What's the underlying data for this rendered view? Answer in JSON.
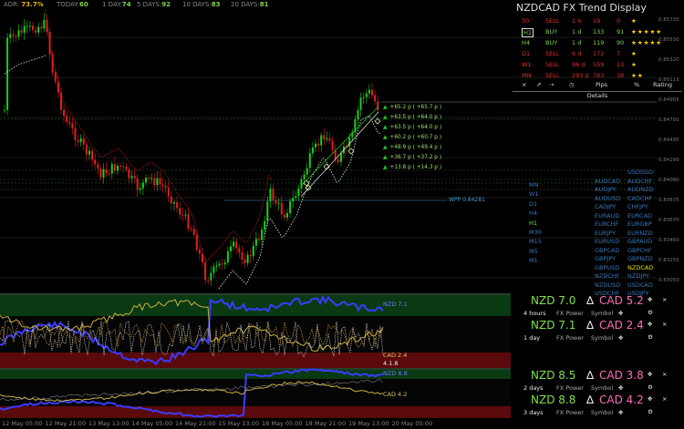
{
  "topbar": {
    "adr_label": "ADR:",
    "adr_value": "73.7%",
    "today_label": "TODAY:",
    "today_value": "60",
    "d1_label": "1 DAY:",
    "d1_value": "74",
    "d5_label": "5 DAYS:",
    "d5_value": "92",
    "d10_label": "10 DAYS:",
    "d10_value": "83",
    "d20_label": "20 DAYS:",
    "d20_value": "81"
  },
  "trend": {
    "title": "NZDCAD FX Trend Display",
    "rows": [
      {
        "tf": "30",
        "dir": "SELL",
        "age": "1 h",
        "pips": "19",
        "pct": "0",
        "stars": "★",
        "color": "#e03030"
      },
      {
        "tf": "H1",
        "dir": "BUY",
        "age": "1 d",
        "pips": "133",
        "pct": "91",
        "stars": "★★★★★",
        "color": "#7fd44f"
      },
      {
        "tf": "H4",
        "dir": "BUY",
        "age": "1 d",
        "pips": "119",
        "pct": "90",
        "stars": "★★★★★",
        "color": "#7fd44f"
      },
      {
        "tf": "D1",
        "dir": "SELL",
        "age": "6 d",
        "pips": "172",
        "pct": "7",
        "stars": "★",
        "color": "#e03030"
      },
      {
        "tf": "W1",
        "dir": "SELL",
        "age": "96 d",
        "pips": "559",
        "pct": "13",
        "stars": "★",
        "color": "#e03030"
      },
      {
        "tf": "MN",
        "dir": "SELL",
        "age": "293 d",
        "pips": "783",
        "pct": "38",
        "stars": "★★",
        "color": "#e03030"
      }
    ],
    "header_pips": "Pips",
    "header_pct": "%",
    "header_rating": "Rating",
    "details_label": "Details",
    "close_glyph": "×",
    "pin_glyph": "⇗",
    "arrow_glyph": "⇢",
    "clock_glyph": "◷"
  },
  "levels": [
    "+65.2 p ( +65.7 p )",
    "+63.5 p ( +64.0 p )",
    "+63.5 p ( +64.0 p )",
    "+60.2 p ( +60.7 p )",
    "+48.9 p ( +49.4 p )",
    "+36.7 p ( +37.2 p )",
    "+13.8 p ( +14.3 p )"
  ],
  "wpp": "WPP  0.84281",
  "matrix": {
    "tfs": [
      "MN",
      "W1",
      "D1",
      "H4",
      "H1",
      "M30",
      "M15",
      "M5",
      "M1"
    ],
    "pairs": [
      {
        "l": "",
        "r": "USDSGD"
      },
      {
        "l": "AUDCAD",
        "r": "AUDCHF"
      },
      {
        "l": "AUDJPY",
        "r": "AUDNZD"
      },
      {
        "l": "AUDUSD",
        "r": "CADCHF"
      },
      {
        "l": "CADJPY",
        "r": "CHFJPY"
      },
      {
        "l": "EURAUD",
        "r": "EURCAD"
      },
      {
        "l": "EURCHF",
        "r": "EURGBP"
      },
      {
        "l": "EURJPY",
        "r": "EURNZD"
      },
      {
        "l": "EURUSD",
        "r": "GBPAUD"
      },
      {
        "l": "GBPCAD",
        "r": "GBPCHF"
      },
      {
        "l": "GBPJPY",
        "r": "GBPNZD"
      },
      {
        "l": "GBPUSD",
        "r": "NZDCAD"
      },
      {
        "l": "NZDCHF",
        "r": "NZDJPY"
      },
      {
        "l": "NZDUSD",
        "r": "USDCAD"
      },
      {
        "l": "USDCHF",
        "r": "USDJPY"
      }
    ],
    "active": "NZDCAD"
  },
  "price_axis": [
    "0.85735",
    "0.85530",
    "0.85320",
    "0.85115",
    "0.84905",
    "0.84700",
    "0.84495",
    "0.84290",
    "0.84080",
    "0.83875",
    "0.83670",
    "0.83460",
    "0.83255",
    "0.83050"
  ],
  "power_panels": [
    {
      "base": "NZD 7.0",
      "quote": "CAD 5.2",
      "period": "4 hours",
      "fx": "FX Power",
      "sym": "Symbol"
    },
    {
      "base": "NZD 7.1",
      "quote": "CAD 2.4",
      "period": "1 day",
      "fx": "FX Power",
      "sym": "Symbol"
    },
    {
      "base": "NZD 8.5",
      "quote": "CAD 3.8",
      "period": "2 days",
      "fx": "FX Power",
      "sym": "Symbol"
    },
    {
      "base": "NZD 8.8",
      "quote": "CAD 4.2",
      "period": "3 days",
      "fx": "FX Power",
      "sym": "Symbol"
    }
  ],
  "band_labels": {
    "nzd1": "NZD 7.1",
    "cad1": "CAD 2.4",
    "val1": "4.1.8",
    "nzd2": "NZD 8.8",
    "cad2": "CAD 4.2"
  },
  "time_axis": [
    "12 May 05:00",
    "12 May 21:00",
    "13 May 13:00",
    "14 May 05:00",
    "14 May 21:00",
    "15 May 13:00",
    "18 May 05:00",
    "18 May 21:00",
    "19 May 13:00",
    "20 May 05:00"
  ],
  "colors": {
    "bull": "#19d019",
    "bear": "#e02020",
    "up": "#7fe04a",
    "down": "#ff6bb8",
    "nzd_line": "#3b3bff",
    "cad_line": "#c8b040"
  }
}
